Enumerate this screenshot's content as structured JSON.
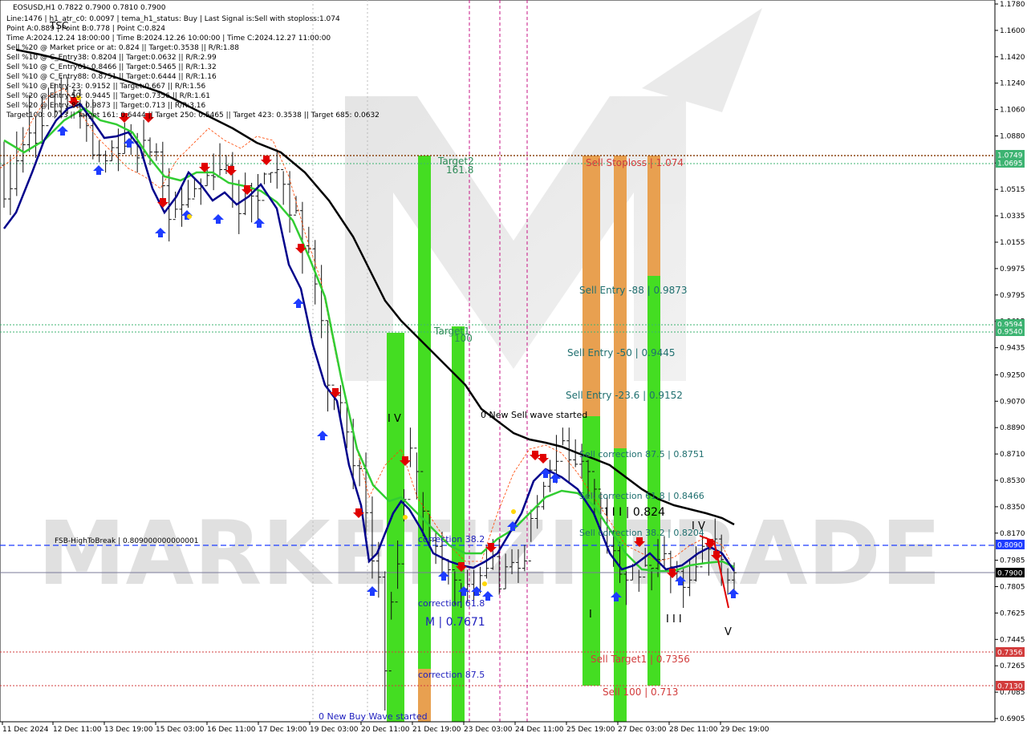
{
  "chart_data": {
    "type": "candlestick",
    "symbol_line": "EOSUSD,H1  0.7822 0.7900 0.7810 0.7900",
    "info_lines": [
      "Line:1476 | h1_atr_c0: 0.0097 | tema_h1_status: Buy | Last Signal is:Sell with stoploss:1.074",
      "Point A:0.889 | Point B:0.778 | Point C:0.824",
      "Time A:2024.12.24 18:00:00 | Time B:2024.12.26 10:00:00 | Time C:2024.12.27 11:00:00",
      "Sell %20 @ Market price or at: 0.824 || Target:0.3538 || R/R:1.88",
      "Sell %10 @ C_Entry38: 0.8204 || Target:0.0632 || R/R:2.99",
      "Sell %10 @ C_Entry61: 0.8466 || Target:0.5465 || R/R:1.32",
      "Sell %10 @ C_Entry88: 0.8751 || Target:0.6444 || R/R:1.16",
      "Sell %10 @ Entry-23: 0.9152 || Target:0.667 || R/R:1.56",
      "Sell %20 @ Entry-50: 0.9445 || Target:0.7356 || R/R:1.61",
      "Sell %20 @ Entry-88: 0.9873 || Target:0.713 || R/R:3.16",
      "Target100: 0.713 || Target 161: 0.6444 || Target 250: 0.5465 || Target 423: 0.3538 || Target 685: 0.0632"
    ],
    "y_ticks": [
      "1.1780",
      "1.1600",
      "1.1420",
      "1.1240",
      "1.1060",
      "1.0880",
      "1.0695",
      "1.0515",
      "1.0335",
      "1.0155",
      "0.9975",
      "0.9795",
      "0.9615",
      "0.9435",
      "0.9250",
      "0.9070",
      "0.8890",
      "0.8710",
      "0.8530",
      "0.8350",
      "0.8170",
      "0.7985",
      "0.7805",
      "0.7625",
      "0.7445",
      "0.7265",
      "0.7085",
      "0.6905"
    ],
    "x_ticks": [
      "11 Dec 2024",
      "12 Dec 11:00",
      "13 Dec 19:00",
      "15 Dec 03:00",
      "16 Dec 11:00",
      "17 Dec 19:00",
      "19 Dec 03:00",
      "20 Dec 11:00",
      "21 Dec 19:00",
      "23 Dec 03:00",
      "24 Dec 11:00",
      "25 Dec 19:00",
      "27 Dec 03:00",
      "28 Dec 11:00",
      "29 Dec 19:00"
    ],
    "price_badges": [
      {
        "text": "1.0749",
        "color": "#3cb371"
      },
      {
        "text": "1.0695",
        "color": "#3cb371"
      },
      {
        "text": "0.9594",
        "color": "#3cb371"
      },
      {
        "text": "0.9540",
        "color": "#3cb371"
      },
      {
        "text": "0.8090",
        "color": "#1e3cff"
      },
      {
        "text": "0.7900",
        "color": "#000000"
      },
      {
        "text": "0.7356",
        "color": "#d23c3c"
      },
      {
        "text": "0.7130",
        "color": "#d23c3c"
      }
    ],
    "annotations": {
      "fsb": "FSB-HighToBreak | 0.809000000000001",
      "target2": "Target2",
      "t1618": "161.8",
      "target1": "Target1",
      "t100": "100",
      "new_sell": "0 New Sell wave started",
      "new_buy": "0 New Buy Wave started",
      "sell_stoploss": "Sell Stoploss | 1.074",
      "sell_entry_88": "Sell Entry -88 | 0.9873",
      "sell_entry_50": "Sell Entry -50 | 0.9445",
      "sell_entry_23": "Sell Entry -23.6 | 0.9152",
      "sell_corr_875": "Sell correction 87.5 | 0.8751",
      "sell_corr_618": "Sell correction 61.8 | 0.8466",
      "sell_corr_382": "Sell correction 38.2 | 0.8204",
      "sell_target1": "Sell Target1 | 0.7356",
      "sell_100": "Sell 100 | 0.713",
      "corr_382": "correction 38.2",
      "corr_618": "correction 61.8",
      "corr_875": "correction 87.5",
      "m_label": "M | 0.7671",
      "iii_824": "I I I | 0.824",
      "wave_iv_top": "I V",
      "wave_iv_right": "I V",
      "wave_i": "I",
      "wave_iii": "I I I",
      "wave_v": "V",
      "tsc": "TSC",
      "watermark": "MARKETIZI TRADE"
    },
    "colors": {
      "bars": "#111111",
      "tema": "#00008b",
      "ma_green": "#32cd32",
      "ma_black": "#000000",
      "env_orange": "#ff4500",
      "zone_green": "#44dd22",
      "zone_orange": "#e8a050",
      "fsb_line": "#1e3cff",
      "target_dotted": "#3cb371",
      "sl_dotted": "#8b4513",
      "red_dotted": "#d23c3c",
      "vline_magenta": "#c71585"
    },
    "candles": [
      [
        1.068,
        1.045,
        1.084,
        1.039
      ],
      [
        1.045,
        1.052,
        1.074,
        1.034
      ],
      [
        1.052,
        1.071,
        1.091,
        1.047
      ],
      [
        1.071,
        1.082,
        1.094,
        1.063
      ],
      [
        1.082,
        1.09,
        1.116,
        1.077
      ],
      [
        1.09,
        1.083,
        1.101,
        1.073
      ],
      [
        1.083,
        1.095,
        1.115,
        1.085
      ],
      [
        1.095,
        1.115,
        1.121,
        1.106
      ],
      [
        1.115,
        1.105,
        1.124,
        1.1
      ],
      [
        1.105,
        1.12,
        1.128,
        1.1
      ],
      [
        1.12,
        1.116,
        1.128,
        1.103
      ],
      [
        1.116,
        1.119,
        1.12,
        1.107
      ],
      [
        1.119,
        1.102,
        1.12,
        1.093
      ],
      [
        1.102,
        1.095,
        1.112,
        1.084
      ],
      [
        1.095,
        1.075,
        1.113,
        1.072
      ],
      [
        1.075,
        1.075,
        1.085,
        1.07
      ],
      [
        1.075,
        1.071,
        1.078,
        1.063
      ],
      [
        1.071,
        1.08,
        1.085,
        1.071
      ],
      [
        1.08,
        1.076,
        1.093,
        1.064
      ],
      [
        1.076,
        1.081,
        1.097,
        1.076
      ],
      [
        1.081,
        1.084,
        1.096,
        1.075
      ],
      [
        1.084,
        1.073,
        1.09,
        1.063
      ],
      [
        1.073,
        1.085,
        1.099,
        1.071
      ],
      [
        1.085,
        1.077,
        1.087,
        1.068
      ],
      [
        1.077,
        1.077,
        1.083,
        1.071
      ],
      [
        1.077,
        1.054,
        1.084,
        1.039
      ],
      [
        1.054,
        1.031,
        1.066,
        1.016
      ],
      [
        1.031,
        1.038,
        1.05,
        1.032
      ],
      [
        1.038,
        1.041,
        1.054,
        1.026
      ],
      [
        1.041,
        1.045,
        1.058,
        1.039
      ],
      [
        1.045,
        1.052,
        1.059,
        1.046
      ],
      [
        1.052,
        1.054,
        1.059,
        1.041
      ],
      [
        1.054,
        1.061,
        1.066,
        1.054
      ],
      [
        1.061,
        1.06,
        1.076,
        1.051
      ],
      [
        1.06,
        1.065,
        1.083,
        1.061
      ],
      [
        1.065,
        1.068,
        1.075,
        1.062
      ],
      [
        1.068,
        1.055,
        1.077,
        1.039
      ],
      [
        1.055,
        1.035,
        1.058,
        1.021
      ],
      [
        1.035,
        1.054,
        1.063,
        1.034
      ],
      [
        1.054,
        1.047,
        1.056,
        1.029
      ],
      [
        1.047,
        1.044,
        1.062,
        1.029
      ],
      [
        1.044,
        1.062,
        1.063,
        1.055
      ],
      [
        1.062,
        1.063,
        1.063,
        1.056
      ],
      [
        1.063,
        1.065,
        1.078,
        1.052
      ],
      [
        1.065,
        1.055,
        1.064,
        1.041
      ],
      [
        1.055,
        1.034,
        1.064,
        1.022
      ],
      [
        1.034,
        1.037,
        1.047,
        1.035
      ],
      [
        1.037,
        1.013,
        1.043,
        0.994
      ],
      [
        1.013,
        1.011,
        1.026,
        1.008
      ],
      [
        1.011,
        0.987,
        1.017,
        0.973
      ],
      [
        0.987,
        0.962,
        1.0,
        0.95
      ],
      [
        0.962,
        0.918,
        0.962,
        0.9
      ],
      [
        0.918,
        0.911,
        0.914,
        0.901
      ],
      [
        0.911,
        0.906,
        0.918,
        0.893
      ],
      [
        0.906,
        0.886,
        0.905,
        0.875
      ],
      [
        0.886,
        0.863,
        0.895,
        0.847
      ],
      [
        0.863,
        0.861,
        0.867,
        0.849
      ],
      [
        0.861,
        0.831,
        0.872,
        0.81
      ],
      [
        0.831,
        0.798,
        0.842,
        0.786
      ],
      [
        0.798,
        0.787,
        0.811,
        0.773
      ],
      [
        0.787,
        0.723,
        0.791,
        0.696
      ],
      [
        0.723,
        0.77,
        0.777,
        0.758
      ],
      [
        0.77,
        0.796,
        0.812,
        0.779
      ],
      [
        0.796,
        0.84,
        0.847,
        0.825
      ],
      [
        0.84,
        0.875,
        0.889,
        0.862
      ],
      [
        0.875,
        0.859,
        0.872,
        0.84
      ],
      [
        0.859,
        0.832,
        0.845,
        0.815
      ],
      [
        0.832,
        0.812,
        0.83,
        0.807
      ],
      [
        0.812,
        0.808,
        0.818,
        0.796
      ],
      [
        0.808,
        0.799,
        0.818,
        0.787
      ],
      [
        0.799,
        0.792,
        0.799,
        0.782
      ],
      [
        0.792,
        0.785,
        0.791,
        0.768
      ],
      [
        0.785,
        0.779,
        0.783,
        0.766
      ],
      [
        0.779,
        0.782,
        0.792,
        0.77
      ],
      [
        0.782,
        0.775,
        0.792,
        0.769
      ],
      [
        0.775,
        0.788,
        0.794,
        0.776
      ],
      [
        0.788,
        0.793,
        0.809,
        0.786
      ],
      [
        0.793,
        0.801,
        0.813,
        0.792
      ],
      [
        0.801,
        0.779,
        0.813,
        0.775
      ],
      [
        0.779,
        0.794,
        0.803,
        0.779
      ],
      [
        0.794,
        0.797,
        0.806,
        0.789
      ],
      [
        0.797,
        0.793,
        0.806,
        0.783
      ],
      [
        0.793,
        0.798,
        0.809,
        0.791
      ],
      [
        0.798,
        0.827,
        0.833,
        0.811
      ],
      [
        0.827,
        0.835,
        0.843,
        0.82
      ],
      [
        0.835,
        0.849,
        0.852,
        0.833
      ],
      [
        0.849,
        0.86,
        0.867,
        0.845
      ],
      [
        0.86,
        0.866,
        0.884,
        0.851
      ],
      [
        0.866,
        0.88,
        0.889,
        0.877
      ],
      [
        0.88,
        0.867,
        0.889,
        0.851
      ],
      [
        0.867,
        0.864,
        0.881,
        0.862
      ],
      [
        0.864,
        0.866,
        0.878,
        0.854
      ],
      [
        0.866,
        0.859,
        0.867,
        0.841
      ],
      [
        0.859,
        0.847,
        0.854,
        0.829
      ],
      [
        0.847,
        0.834,
        0.845,
        0.819
      ],
      [
        0.834,
        0.808,
        0.842,
        0.803
      ],
      [
        0.808,
        0.805,
        0.819,
        0.794
      ],
      [
        0.805,
        0.789,
        0.811,
        0.783
      ],
      [
        0.789,
        0.785,
        0.791,
        0.768
      ],
      [
        0.785,
        0.795,
        0.796,
        0.785
      ],
      [
        0.795,
        0.787,
        0.792,
        0.777
      ],
      [
        0.787,
        0.795,
        0.807,
        0.794
      ],
      [
        0.795,
        0.793,
        0.793,
        0.778
      ],
      [
        0.793,
        0.799,
        0.813,
        0.787
      ],
      [
        0.799,
        0.803,
        0.815,
        0.793
      ],
      [
        0.803,
        0.794,
        0.805,
        0.776
      ],
      [
        0.794,
        0.791,
        0.798,
        0.784
      ],
      [
        0.791,
        0.78,
        0.794,
        0.766
      ],
      [
        0.78,
        0.785,
        0.799,
        0.774
      ],
      [
        0.785,
        0.794,
        0.808,
        0.784
      ],
      [
        0.794,
        0.808,
        0.817,
        0.796
      ],
      [
        0.808,
        0.806,
        0.812,
        0.788
      ],
      [
        0.806,
        0.813,
        0.827,
        0.803
      ],
      [
        0.813,
        0.799,
        0.816,
        0.781
      ],
      [
        0.799,
        0.785,
        0.793,
        0.775
      ],
      [
        0.785,
        0.79,
        0.797,
        0.776
      ]
    ]
  }
}
